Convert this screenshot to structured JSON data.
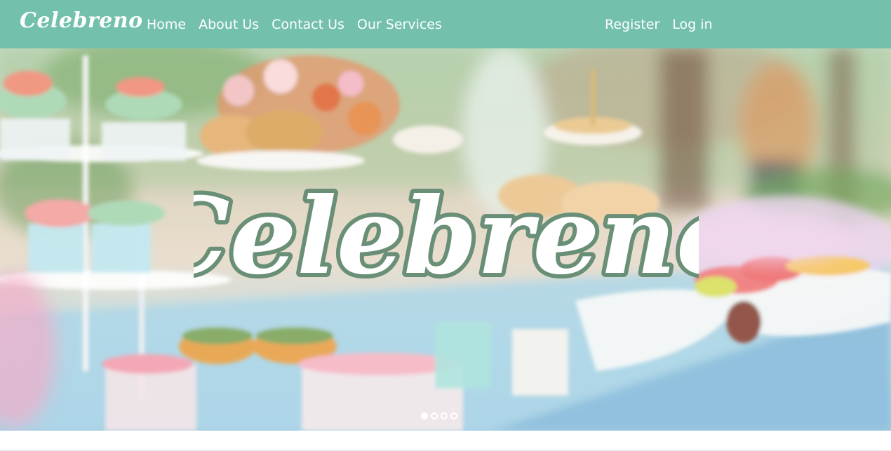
{
  "navbar": {
    "brand": "Celebreno",
    "left_links": [
      "Home",
      "About Us",
      "Contact Us",
      "Our Services"
    ],
    "right_links": [
      "Register",
      "Log in"
    ]
  },
  "hero": {
    "logo_text": "Celebreno",
    "carousel": {
      "slides": 4,
      "active": 0
    }
  },
  "colors": {
    "navbar": "#73c0ad",
    "logo_outline": "#6a8f77",
    "white": "#ffffff"
  }
}
